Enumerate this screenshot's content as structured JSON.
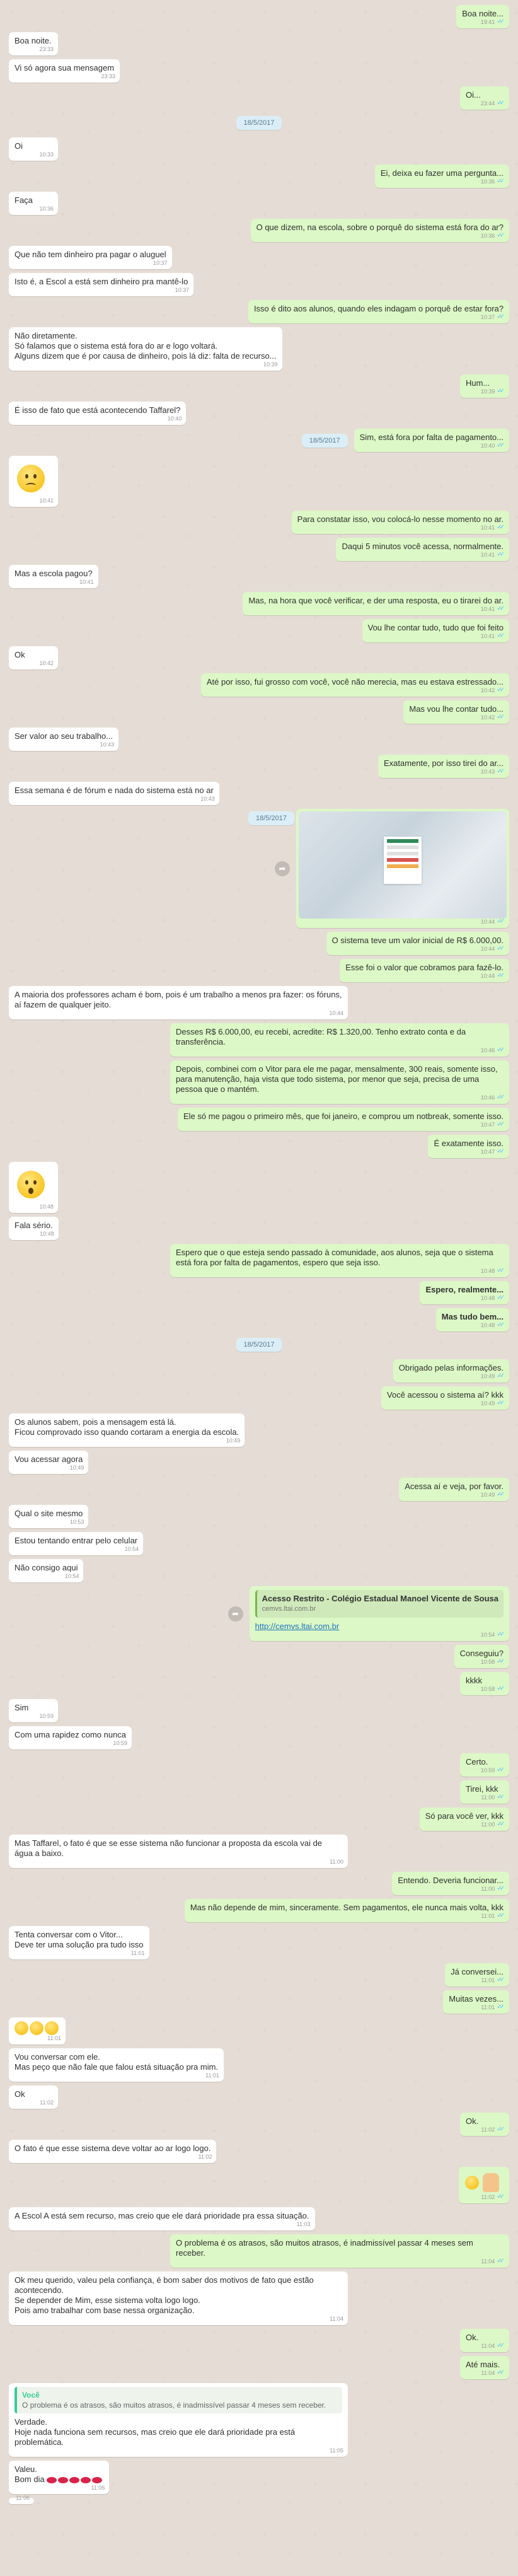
{
  "colors": {
    "outgoing_bubble": "#dcf8c6",
    "incoming_bubble": "#ffffff",
    "chat_background": "#e5ddd5",
    "read_tick": "#4fc3f7",
    "date_pill": "#dbeef8"
  },
  "icons": {
    "read_receipt": "double-check-icon",
    "share": "forward-icon"
  },
  "messages": [
    {
      "dir": "out",
      "text": "Boa noite...",
      "time": "19:41",
      "tick": true
    },
    {
      "dir": "in",
      "text": "Boa noite.",
      "time": "23:33"
    },
    {
      "dir": "in",
      "text": "Vi só agora sua mensagem",
      "time": "23:33"
    },
    {
      "dir": "out",
      "text": "Oi...",
      "time": "23:44",
      "tick": true
    },
    {
      "dir": "date",
      "text": "18/5/2017"
    },
    {
      "dir": "in",
      "text": "Oi",
      "time": "10:33"
    },
    {
      "dir": "out",
      "text": "Ei, deixa eu fazer uma pergunta...",
      "time": "10:36",
      "tick": true
    },
    {
      "dir": "in",
      "text": "Faça",
      "time": "10:36"
    },
    {
      "dir": "out",
      "text": "O que dizem, na escola, sobre o porquê do sistema está fora do ar?",
      "time": "10:36",
      "tick": true
    },
    {
      "dir": "in",
      "text": "Que não tem dinheiro pra pagar o aluguel",
      "time": "10:37"
    },
    {
      "dir": "in",
      "text": "Isto é, a Escol a está sem dinheiro pra mantê-lo",
      "time": "10:37"
    },
    {
      "dir": "out",
      "text": "Isso é dito aos alunos, quando eles indagam o porquê de estar fora?",
      "time": "10:37",
      "tick": true
    },
    {
      "dir": "in",
      "text": "Não diretamente.\nSó falamos que o sistema está fora do ar e logo voltará.\nAlguns dizem que é por causa de dinheiro, pois lá diz: falta de recurso...",
      "time": "10:39"
    },
    {
      "dir": "out",
      "text": "Hum...",
      "time": "10:39",
      "tick": true
    },
    {
      "dir": "in",
      "text": "É isso de fato que está acontecendo Taffarel?",
      "time": "10:40"
    },
    {
      "dir": "outdate",
      "date": "18/5/2017",
      "text": "Sim, está fora por falta de pagamento...",
      "time": "10:40",
      "tick": true
    },
    {
      "dir": "in",
      "emoji": "sad",
      "time": "10:41"
    },
    {
      "dir": "out",
      "text": "Para constatar isso, vou colocá-lo nesse momento no ar.",
      "time": "10:41",
      "tick": true
    },
    {
      "dir": "out",
      "text": "Daqui 5 minutos você acessa, normalmente.",
      "time": "10:41",
      "tick": true
    },
    {
      "dir": "in",
      "text": "Mas a escola pagou?",
      "time": "10:41"
    },
    {
      "dir": "out",
      "text": "Mas, na hora que você verificar, e der uma resposta, eu o tirarei do ar.",
      "time": "10:41",
      "tick": true
    },
    {
      "dir": "out",
      "text": "Vou lhe contar tudo, tudo que foi feito",
      "time": "10:41",
      "tick": true
    },
    {
      "dir": "in",
      "text": "Ok",
      "time": "10:42"
    },
    {
      "dir": "out",
      "text": "Até por isso, fui grosso com você, você não merecia, mas eu estava estressado...",
      "time": "10:42",
      "tick": true
    },
    {
      "dir": "out",
      "text": "Mas vou lhe contar tudo...",
      "time": "10:42",
      "tick": true
    },
    {
      "dir": "in",
      "text": "Ser valor ao seu trabalho...",
      "time": "10:43"
    },
    {
      "dir": "out",
      "text": "Exatamente, por isso tirei do ar...",
      "time": "10:43",
      "tick": true
    },
    {
      "dir": "in",
      "text": "Essa semana é de fórum e nada do sistema está no ar",
      "time": "10:43"
    },
    {
      "dir": "outimage",
      "date": "18/5/2017",
      "time": "10:44",
      "tick": true
    },
    {
      "dir": "out",
      "text": "O sistema teve um valor inicial de R$ 6.000,00.",
      "time": "10:44",
      "tick": true
    },
    {
      "dir": "out",
      "text": "Esse foi o valor que cobramos para fazê-lo.",
      "time": "10:44",
      "tick": true
    },
    {
      "dir": "in",
      "text": "A maioria dos professores acham é bom, pois é um trabalho a menos pra fazer: os fóruns, aí fazem de qualquer jeito.",
      "time": "10:44"
    },
    {
      "dir": "out",
      "text": "Desses R$ 6.000,00, eu recebi, acredite: R$ 1.320,00. Tenho extrato conta e da transferência.",
      "time": "10:46",
      "tick": true
    },
    {
      "dir": "out",
      "text": "Depois, combinei com o Vitor para ele me pagar, mensalmente, 300 reais, somente isso, para manutenção, haja vista que todo sistema, por menor que seja, precisa de uma pessoa que o mantém.",
      "time": "10:46",
      "tick": true
    },
    {
      "dir": "out",
      "text": "Ele só me pagou o primeiro mês, que foi janeiro, e comprou um notbreak, somente isso.",
      "time": "10:47",
      "tick": true
    },
    {
      "dir": "out",
      "text": "É exatamente isso.",
      "time": "10:47",
      "tick": true
    },
    {
      "dir": "in",
      "emoji": "shock",
      "time": "10:48"
    },
    {
      "dir": "in",
      "text": "Fala sério.",
      "time": "10:48"
    },
    {
      "dir": "out",
      "text": "Espero que o que esteja sendo passado à comunidade, aos alunos, seja que o sistema está fora por falta de pagamentos, espero que seja isso.",
      "time": "10:48",
      "tick": true
    },
    {
      "dir": "out",
      "text": "Espero, realmente...",
      "time": "10:48",
      "tick": true,
      "bold": true
    },
    {
      "dir": "out",
      "text": "Mas tudo bem...",
      "time": "10:48",
      "tick": true,
      "bold": true
    },
    {
      "dir": "date",
      "text": "18/5/2017"
    },
    {
      "dir": "out",
      "text": "Obrigado pelas informações.",
      "time": "10:49",
      "tick": true
    },
    {
      "dir": "out",
      "text": "Você acessou o sistema aí? kkk",
      "time": "10:49",
      "tick": true
    },
    {
      "dir": "in",
      "text": "Os alunos sabem, pois a mensagem está lá.\nFicou comprovado isso quando cortaram a energia da escola.",
      "time": "10:49"
    },
    {
      "dir": "in",
      "text": "Vou acessar agora",
      "time": "10:49"
    },
    {
      "dir": "out",
      "text": "Acessa aí e veja, por favor.",
      "time": "10:49",
      "tick": true
    },
    {
      "dir": "in",
      "text": "Qual o site mesmo",
      "time": "10:53"
    },
    {
      "dir": "in",
      "text": "Estou tentando entrar pelo celular",
      "time": "10:54"
    },
    {
      "dir": "in",
      "text": "Não consigo aqui",
      "time": "10:54"
    },
    {
      "dir": "outlink",
      "title": "Acesso Restrito - Colégio Estadual Manoel Vicente de Sousa",
      "domain": "cemvs.ltai.com.br",
      "url": "http://cemvs.ltai.com.br",
      "time": "10:54",
      "tick": true
    },
    {
      "dir": "out",
      "text": "Conseguiu?",
      "time": "10:58",
      "tick": true
    },
    {
      "dir": "out",
      "text": "kkkk",
      "time": "10:58",
      "tick": true
    },
    {
      "dir": "in",
      "text": "Sim",
      "time": "10:59"
    },
    {
      "dir": "in",
      "text": "Com uma rapidez como nunca",
      "time": "10:59"
    },
    {
      "dir": "out",
      "text": "Certo.",
      "time": "10:59",
      "tick": true
    },
    {
      "dir": "out",
      "text": "Tirei, kkk",
      "time": "11:00",
      "tick": true
    },
    {
      "dir": "out",
      "text": "Só para você ver, kkk",
      "time": "11:00",
      "tick": true
    },
    {
      "dir": "in",
      "text": "Mas Taffarel, o fato é que se esse sistema não funcionar a proposta da escola vai de água a baixo.",
      "time": "11:00"
    },
    {
      "dir": "out",
      "text": "Entendo. Deveria funcionar...",
      "time": "11:00",
      "tick": true
    },
    {
      "dir": "out",
      "text": "Mas não depende de mim, sinceramente. Sem pagamentos, ele nunca mais volta, kkk",
      "time": "11:01",
      "tick": true
    },
    {
      "dir": "in",
      "text": "Tenta conversar com o Vitor...\nDeve ter uma solução pra tudo isso",
      "time": "11:01"
    },
    {
      "dir": "out",
      "text": "Já conversei...",
      "time": "11:01",
      "tick": true
    },
    {
      "dir": "out",
      "text": "Muitas vezes...",
      "time": "11:01",
      "tick": true
    },
    {
      "dir": "in",
      "emoji": "three",
      "time": "11:01"
    },
    {
      "dir": "in",
      "text": "Vou conversar com ele.\nMas peço que não fale que falou está situação pra mim.",
      "time": "11:01"
    },
    {
      "dir": "in",
      "text": "Ok",
      "time": "11:02"
    },
    {
      "dir": "out",
      "text": "Ok.",
      "time": "11:02",
      "tick": true
    },
    {
      "dir": "in",
      "text": "O fato é que esse sistema deve voltar ao ar logo logo.",
      "time": "11:02"
    },
    {
      "dir": "out",
      "emoji": "thumb",
      "time": "11:02",
      "tick": true
    },
    {
      "dir": "in",
      "text": "A Escol A está sem recurso, mas creio que ele dará prioridade pra essa situação.",
      "time": "11:03"
    },
    {
      "dir": "out",
      "text": "O problema é os atrasos, são muitos atrasos, é inadmissível passar 4 meses sem receber.",
      "time": "11:04",
      "tick": true
    },
    {
      "dir": "in",
      "text": "Ok meu querido, valeu pela confiança, é bom saber dos motivos de fato que estão acontecendo.\nSe depender de Mim, esse sistema volta logo logo.\nPois amo trabalhar com base nessa organização.",
      "time": "11:04"
    },
    {
      "dir": "out",
      "text": "Ok.",
      "time": "11:04",
      "tick": true
    },
    {
      "dir": "out",
      "text": "Até mais.",
      "time": "11:04",
      "tick": true
    },
    {
      "dir": "inquote",
      "quote_author": "Você",
      "quote_text": "O problema é os atrasos, são muitos atrasos, é inadmissível passar 4 meses sem receber.",
      "text": "Verdade.\nHoje nada funciona sem recursos, mas creio que ele dará prioridade pra está problemática.",
      "time": "11:05"
    },
    {
      "dir": "in",
      "text": "Valeu.\nBom dia",
      "emoji": "lips",
      "time": "11:06"
    },
    {
      "dir": "in",
      "emoji": "smalltail",
      "time": "11:06"
    }
  ]
}
